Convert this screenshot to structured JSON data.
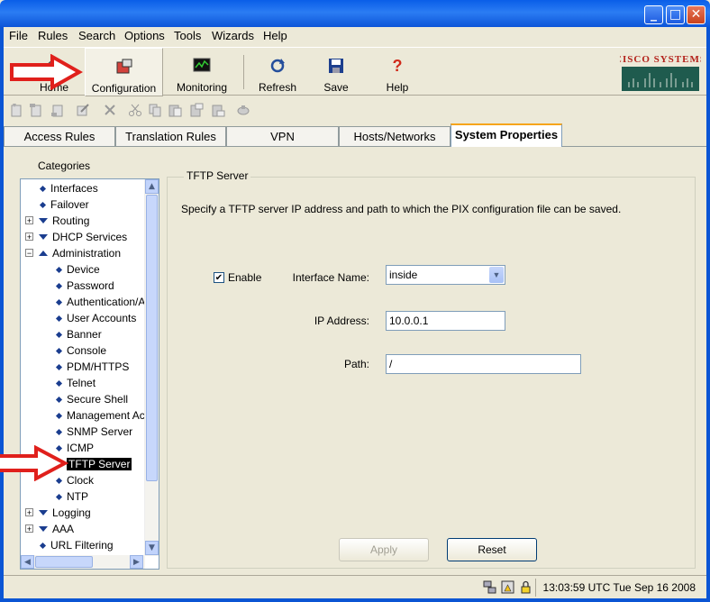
{
  "menu": [
    "File",
    "Rules",
    "Search",
    "Options",
    "Tools",
    "Wizards",
    "Help"
  ],
  "toolbar": {
    "home": "Home",
    "configuration": "Configuration",
    "monitoring": "Monitoring",
    "refresh": "Refresh",
    "save": "Save",
    "help": "Help"
  },
  "brand": "Cisco Systems",
  "tabs": [
    "Access Rules",
    "Translation Rules",
    "VPN",
    "Hosts/Networks",
    "System Properties"
  ],
  "categories_label": "Categories",
  "tree": [
    {
      "label": "Interfaces",
      "level": 0,
      "icon": "diamond"
    },
    {
      "label": "Failover",
      "level": 0,
      "icon": "diamond"
    },
    {
      "label": "Routing",
      "level": 0,
      "icon": "triangle",
      "expander": "+"
    },
    {
      "label": "DHCP Services",
      "level": 0,
      "icon": "triangle",
      "expander": "+"
    },
    {
      "label": "Administration",
      "level": 0,
      "icon": "triangle-up",
      "expander": "-"
    },
    {
      "label": "Device",
      "level": 1,
      "icon": "diamond"
    },
    {
      "label": "Password",
      "level": 1,
      "icon": "diamond"
    },
    {
      "label": "Authentication/A",
      "level": 1,
      "icon": "diamond"
    },
    {
      "label": "User Accounts",
      "level": 1,
      "icon": "diamond"
    },
    {
      "label": "Banner",
      "level": 1,
      "icon": "diamond"
    },
    {
      "label": "Console",
      "level": 1,
      "icon": "diamond"
    },
    {
      "label": "PDM/HTTPS",
      "level": 1,
      "icon": "diamond"
    },
    {
      "label": "Telnet",
      "level": 1,
      "icon": "diamond"
    },
    {
      "label": "Secure Shell",
      "level": 1,
      "icon": "diamond"
    },
    {
      "label": "Management Ac",
      "level": 1,
      "icon": "diamond"
    },
    {
      "label": "SNMP Server",
      "level": 1,
      "icon": "diamond"
    },
    {
      "label": "ICMP",
      "level": 1,
      "icon": "diamond"
    },
    {
      "label": "TFTP Server",
      "level": 1,
      "icon": "diamond",
      "selected": true
    },
    {
      "label": "Clock",
      "level": 1,
      "icon": "diamond"
    },
    {
      "label": "NTP",
      "level": 1,
      "icon": "diamond"
    },
    {
      "label": "Logging",
      "level": 0,
      "icon": "triangle",
      "expander": "+"
    },
    {
      "label": "AAA",
      "level": 0,
      "icon": "triangle",
      "expander": "+"
    },
    {
      "label": "URL Filtering",
      "level": 0,
      "icon": "diamond"
    }
  ],
  "panel": {
    "title": "TFTP Server",
    "description": "Specify a TFTP server IP address and path to which the PIX configuration file can be saved.",
    "enable_label": "Enable",
    "enable_checked": "✔",
    "interface_label": "Interface Name:",
    "interface_value": "inside",
    "ip_label": "IP Address:",
    "ip_value": "10.0.0.1",
    "path_label": "Path:",
    "path_value": "/",
    "apply": "Apply",
    "reset": "Reset"
  },
  "status": {
    "clock": "13:03:59 UTC Tue Sep 16 2008"
  },
  "colors": {
    "titlebar": "#0a5ee8",
    "annotation_arrow": "#e0201c",
    "selection": "#000000"
  }
}
